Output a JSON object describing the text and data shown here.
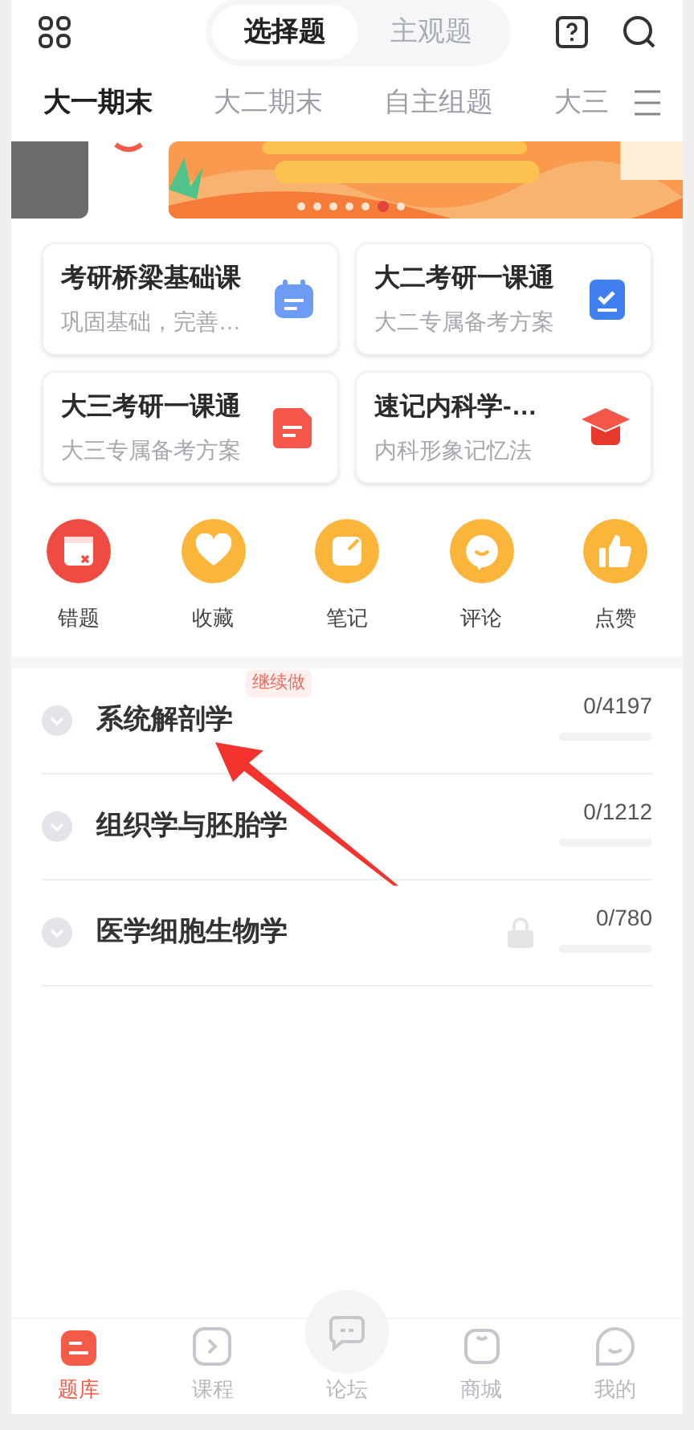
{
  "mode_tabs": [
    {
      "label": "选择题",
      "selected": true
    },
    {
      "label": "主观题",
      "selected": false
    }
  ],
  "category_tabs": [
    {
      "label": "大一期末",
      "selected": true
    },
    {
      "label": "大二期末",
      "selected": false
    },
    {
      "label": "自主组题",
      "selected": false
    },
    {
      "label": "大三",
      "selected": false
    }
  ],
  "banner": {
    "dots": [
      {
        "selected": false
      },
      {
        "selected": false
      },
      {
        "selected": false
      },
      {
        "selected": false
      },
      {
        "selected": false
      },
      {
        "selected": true
      },
      {
        "selected": false
      }
    ]
  },
  "courses": [
    {
      "title": "考研桥梁基础课",
      "subtitle": "巩固基础，完善…",
      "kind": "calendar"
    },
    {
      "title": "大二考研一课通",
      "subtitle": "大二专属备考方案",
      "kind": "clipboard"
    },
    {
      "title": "大三考研一课通",
      "subtitle": "大三专属备考方案",
      "kind": "document"
    },
    {
      "title": "速记内科学-…",
      "subtitle": "内科形象记忆法",
      "kind": "cap"
    }
  ],
  "shortcuts": [
    {
      "label": "错题",
      "kind": "wrong"
    },
    {
      "label": "收藏",
      "kind": "heart"
    },
    {
      "label": "笔记",
      "kind": "note"
    },
    {
      "label": "评论",
      "kind": "comment"
    },
    {
      "label": "点赞",
      "kind": "like"
    }
  ],
  "subjects": [
    {
      "name": "系统解剖学",
      "badge": "继续做",
      "locked": false,
      "count": "0/4197",
      "level": 0
    },
    {
      "name": "组织学与胚胎学",
      "locked": false,
      "count": "0/1212",
      "level": 0
    },
    {
      "name": "医学细胞生物学",
      "locked": true,
      "count": "0/780",
      "level": 0
    }
  ],
  "bottom_nav": [
    {
      "label": "题库",
      "kind": "bank",
      "selected": true
    },
    {
      "label": "课程",
      "kind": "course",
      "selected": false
    },
    {
      "label": "论坛",
      "kind": "forum",
      "selected": false
    },
    {
      "label": "商城",
      "kind": "shop",
      "selected": false
    },
    {
      "label": "我的",
      "kind": "me",
      "selected": false
    }
  ]
}
